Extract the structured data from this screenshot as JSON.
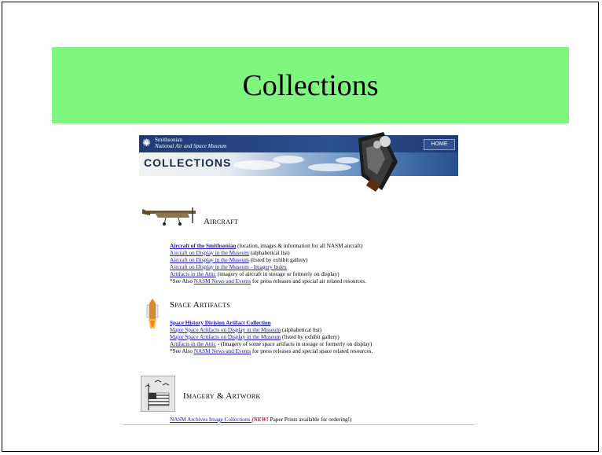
{
  "slide": {
    "title": "Collections"
  },
  "banner": {
    "org_line1": "Smithsonian",
    "org_line2": "National Air and Space Museum",
    "home_label": "HOME",
    "title": "COLLECTIONS"
  },
  "aircraft": {
    "heading": "Aircraft",
    "links": [
      {
        "link": "Aircraft of the Smithsonian",
        "text": " (location, images & information for all NASM aircraft)"
      },
      {
        "link": "Aircraft on Display in the Museum",
        "text": " (alphabetical list)"
      },
      {
        "link": "Aircraft on Display in the Museum",
        "text": " (listed by exhibit gallery)"
      },
      {
        "link": "Aircraft on Display in the Museum - Imagery Index",
        "text": ""
      },
      {
        "link": "Artifacts in the Attic",
        "text": " (imagery of aircraft in storage or formerly on display)"
      }
    ],
    "see_also_prefix": "*See Also ",
    "see_also_link": "NASM News and Events",
    "see_also_suffix": " for press releases and special air related resources."
  },
  "space": {
    "heading": "Space Artifacts",
    "links": [
      {
        "link": "Space History Division Artifact Collection",
        "text": ""
      },
      {
        "link": "Major Space Artifacts on Display in the Museum",
        "text": " (alphabetical list)"
      },
      {
        "link": "Major Space Artifacts on Display in the Museum",
        "text": " (listed by exhibit gallery)"
      },
      {
        "link": "Artifacts in the Attic",
        "text": " - (Imagery of some space artifacts in storage or formerly on display)"
      }
    ],
    "see_also_prefix": "*See Also ",
    "see_also_link": "NASM News and Events",
    "see_also_suffix": " for press releases and special space related resources."
  },
  "imagery": {
    "heading": "Imagery & Artwork",
    "line_prefix": "NASM Archives Image Collections ",
    "new_tag": "(NEW!",
    "line_suffix": " Paper Prints available for ordering!)"
  }
}
